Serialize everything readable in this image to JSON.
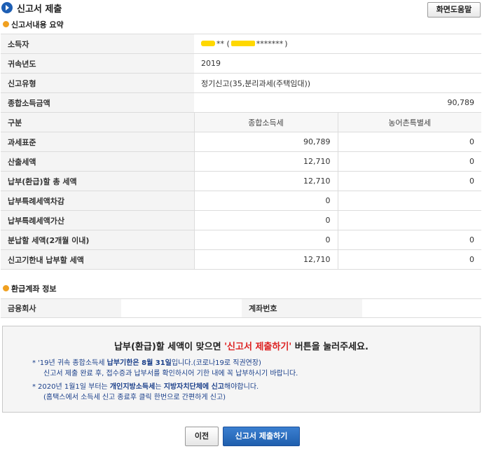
{
  "header": {
    "title": "신고서 제출",
    "help_button": "화면도움말"
  },
  "summary": {
    "section_title": "신고서내용 요약",
    "rows": [
      {
        "label": "소득자",
        "value_name_suffix": "** (",
        "value_masked": "*******",
        "value_close": ")"
      },
      {
        "label": "귀속년도",
        "value": "2019"
      },
      {
        "label": "신고유형",
        "value": "정기신고(35,분리과세(주택임대))"
      },
      {
        "label": "종합소득금액",
        "value": "90,789"
      }
    ],
    "col_header": {
      "label": "구분",
      "col1": "종합소득세",
      "col2": "농어촌특별세"
    },
    "tax_rows": [
      {
        "label": "과세표준",
        "v1": "90,789",
        "v2": "0"
      },
      {
        "label": "산출세액",
        "v1": "12,710",
        "v2": "0"
      },
      {
        "label": "납부(환급)할 총 세액",
        "v1": "12,710",
        "v2": "0"
      },
      {
        "label": "납부특례세액차감",
        "v1": "0",
        "v2": ""
      },
      {
        "label": "납부특례세액가산",
        "v1": "0",
        "v2": ""
      },
      {
        "label": "분납할 세액(2개월 이내)",
        "v1": "0",
        "v2": "0"
      },
      {
        "label": "신고기한내 납부할 세액",
        "v1": "12,710",
        "v2": "0"
      }
    ]
  },
  "refund": {
    "section_title": "환급계좌 정보",
    "bank_label": "금융회사",
    "bank_value": "",
    "account_label": "계좌번호",
    "account_value": ""
  },
  "notice": {
    "main_prefix": "납부(환급)할 세액이 맞으면 ",
    "main_highlight": "'신고서 제출하기'",
    "main_suffix": " 버튼을 눌러주세요.",
    "b1_l1_a": "'19년 귀속 종합소득세 ",
    "b1_l1_b": "납부기한은 8월 31일",
    "b1_l1_c": "입니다.(코로나19로 직권연장)",
    "b1_l2": "신고서 제출 완료 후, 접수증과 납부서를 확인하시어 기한 내에 꼭 납부하시기 바랍니다.",
    "b2_l1_a": "2020년 1월1일 부터는 ",
    "b2_l1_b": "개인지방소득세",
    "b2_l1_c": "는 ",
    "b2_l1_d": "지방자치단체에 신고",
    "b2_l1_e": "해야합니다.",
    "b2_l2": "(홈택스에서 소득세 신고 종료후 클릭 한번으로 간편하게 신고)"
  },
  "buttons": {
    "prev": "이전",
    "submit": "신고서 제출하기"
  },
  "colors": {
    "title_icon": "#1e5fb4",
    "section_icon": "#f0a020",
    "highlight": "#d22222",
    "mask": "#ffd800",
    "submit_bg": "#1f5fae"
  }
}
